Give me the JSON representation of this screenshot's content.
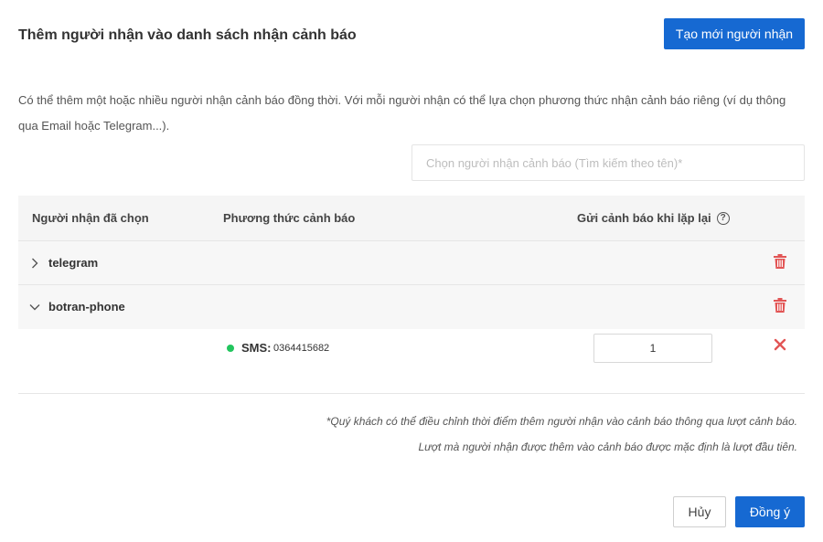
{
  "modal": {
    "title": "Thêm người nhận vào danh sách nhận cảnh báo",
    "create_button_label": "Tạo mới người nhận",
    "description": "Có thể thêm một hoặc nhiều người nhận cảnh báo đồng thời. Với mỗi người nhận có thể lựa chọn phương thức nhận cảnh báo riêng (ví dụ thông qua Email hoặc Telegram...).",
    "search": {
      "placeholder": "Chọn người nhận cảnh báo (Tìm kiếm theo tên)*",
      "value": ""
    }
  },
  "table": {
    "columns": [
      "Người nhận đã chọn",
      "Phương thức cảnh báo",
      "Gửi cảnh báo khi lặp lại"
    ],
    "help_icon_glyph": "?",
    "rows": [
      {
        "name": "telegram",
        "expanded": false,
        "chevron": "›"
      },
      {
        "name": "botran-phone",
        "expanded": true,
        "chevron": "⌄",
        "methods": [
          {
            "type_label": "SMS:",
            "value": "0364415682",
            "status_color": "#22c55e",
            "repeat": "1"
          }
        ]
      }
    ]
  },
  "notes": [
    "*Quý khách có thể điều chỉnh thời điểm thêm người nhận vào cảnh báo thông qua lượt cảnh báo.",
    "Lượt mà người nhận được thêm vào cảnh báo được mặc định là lượt đầu tiên."
  ],
  "footer": {
    "cancel_label": "Hủy",
    "ok_label": "Đồng ý"
  },
  "colors": {
    "primary": "#1669d2",
    "danger": "#e25555",
    "status_active": "#22c55e"
  }
}
